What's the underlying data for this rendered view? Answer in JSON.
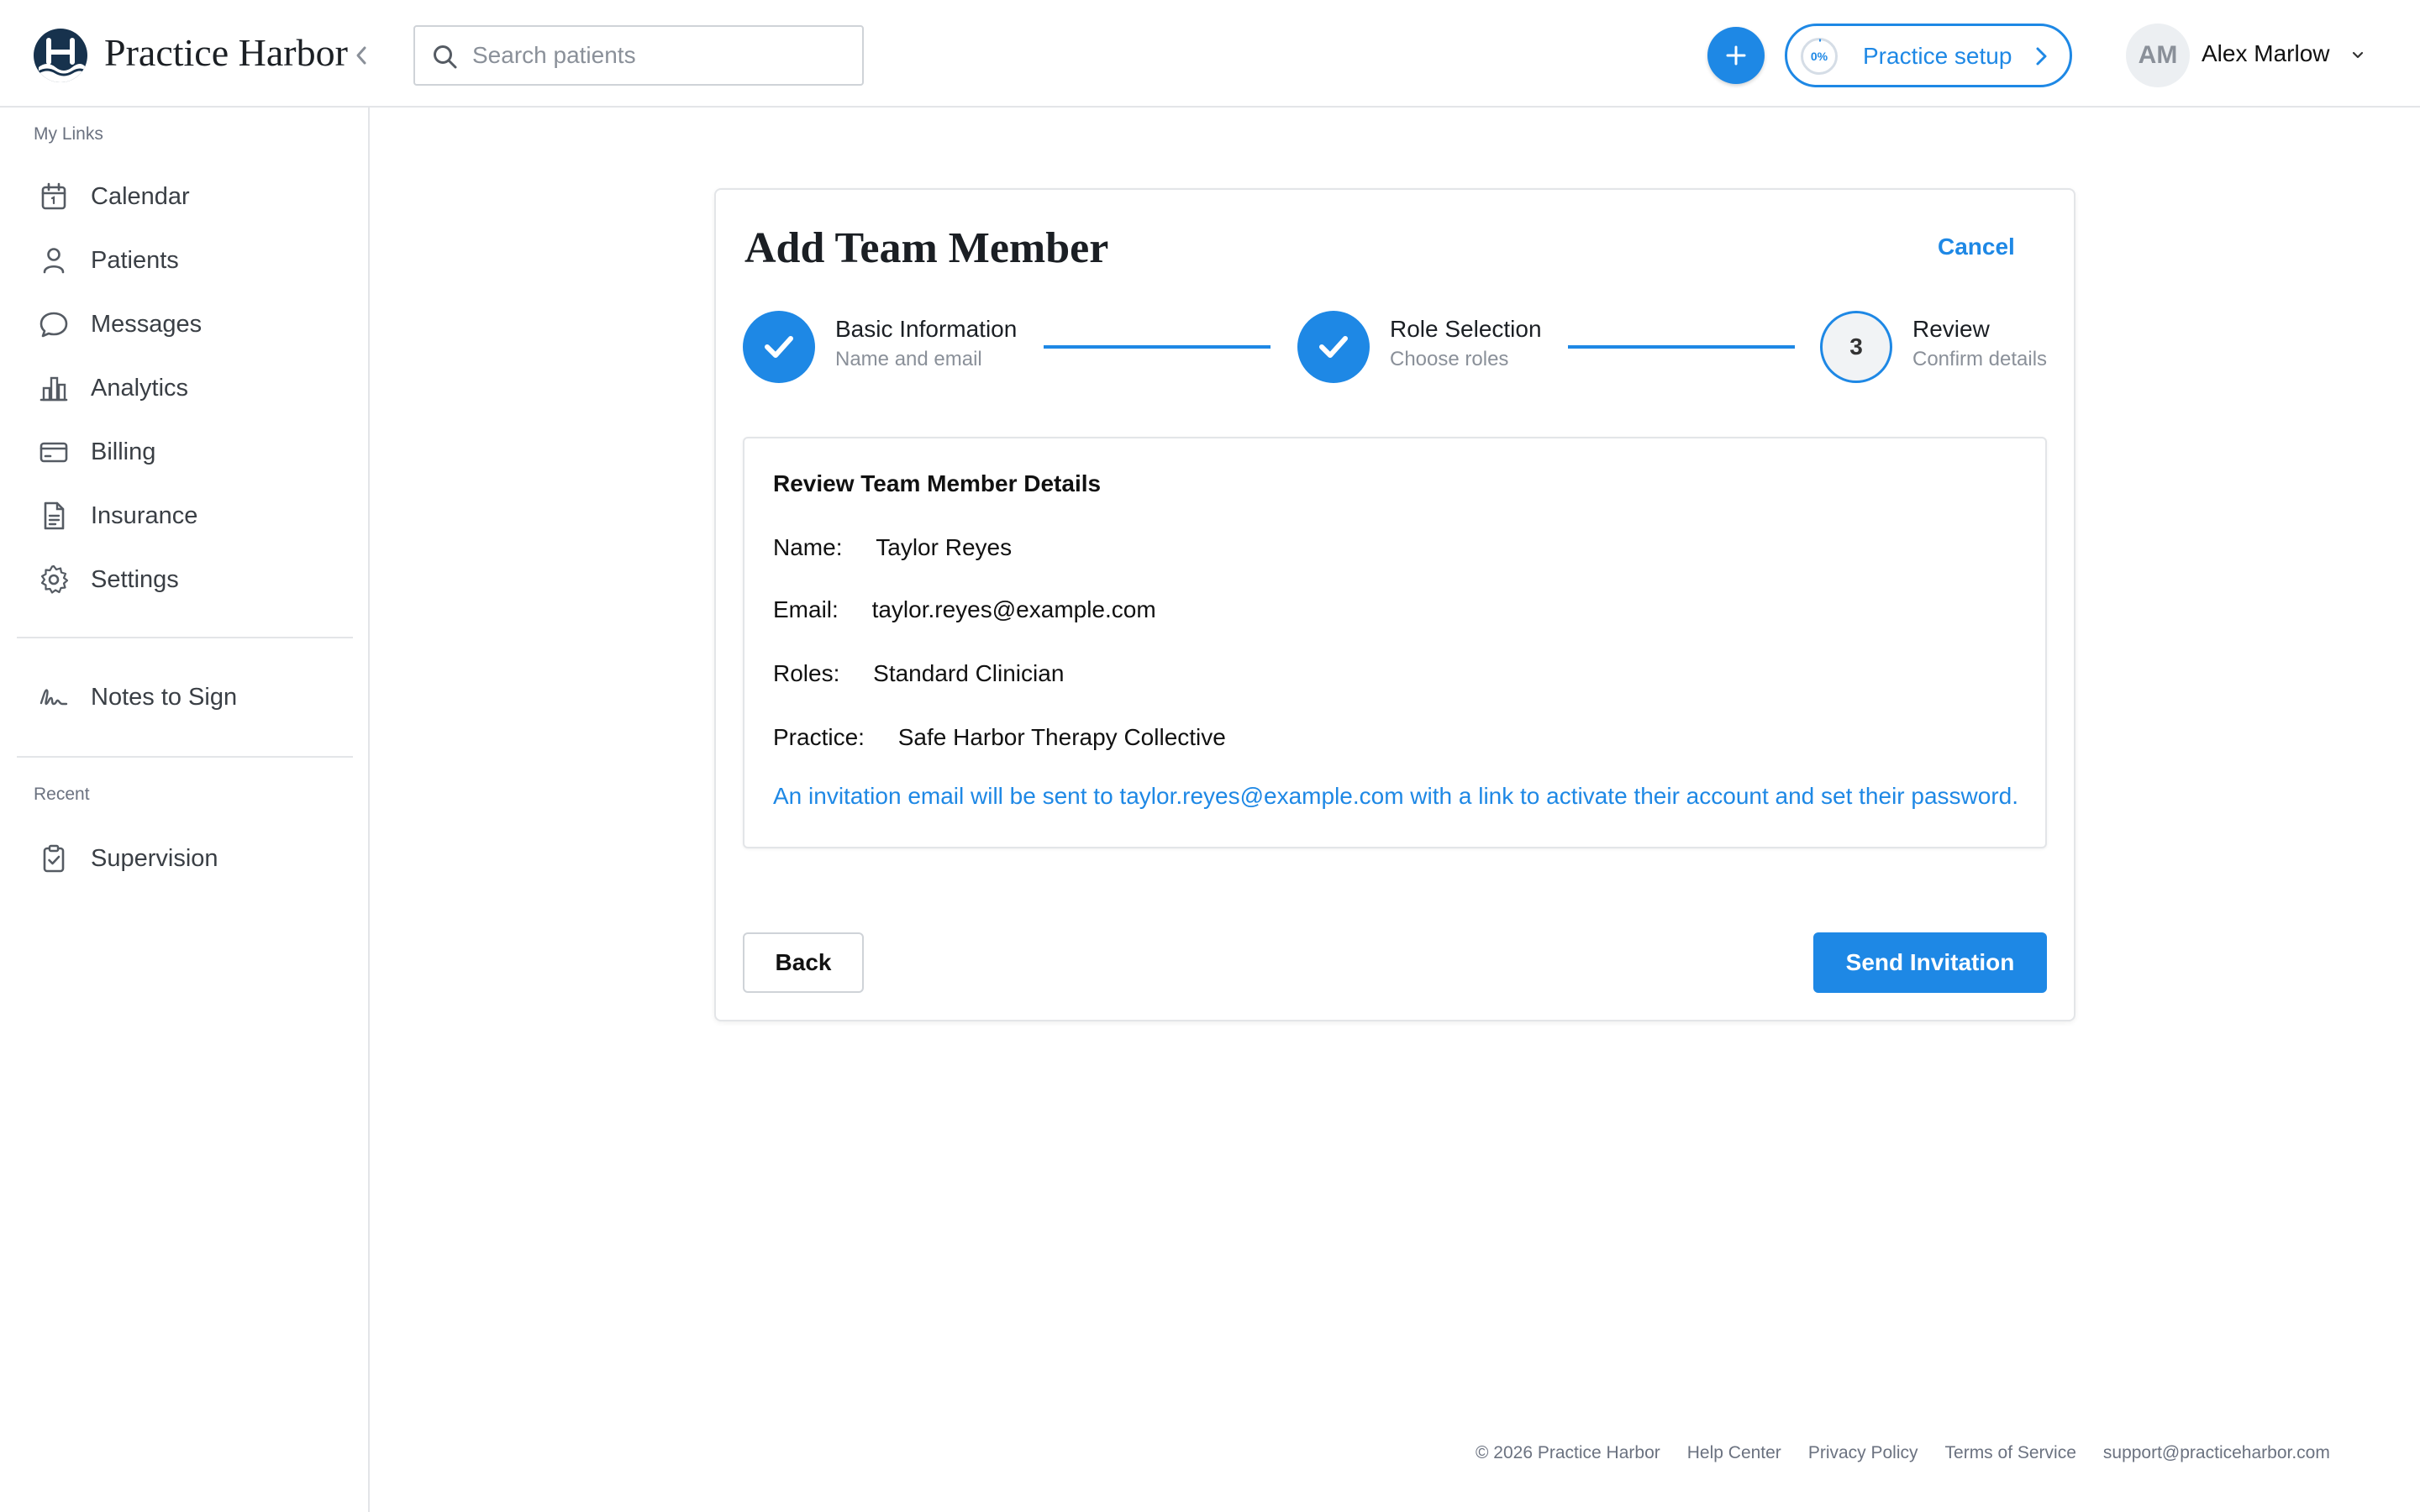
{
  "brand": {
    "name": "Practice Harbor"
  },
  "search": {
    "placeholder": "Search patients"
  },
  "header": {
    "setup_progress": "0%",
    "setup_label": "Practice setup",
    "avatar_initials": "AM",
    "user_name": "Alex Marlow",
    "accent_color": "#1e88e5"
  },
  "sidebar": {
    "my_links_label": "My Links",
    "items": [
      {
        "label": "Calendar",
        "icon": "calendar-icon"
      },
      {
        "label": "Patients",
        "icon": "user-icon"
      },
      {
        "label": "Messages",
        "icon": "message-icon"
      },
      {
        "label": "Analytics",
        "icon": "bar-chart-icon"
      },
      {
        "label": "Billing",
        "icon": "credit-card-icon"
      },
      {
        "label": "Insurance",
        "icon": "document-icon"
      },
      {
        "label": "Settings",
        "icon": "gear-icon"
      }
    ],
    "notes_to_sign": {
      "label": "Notes to Sign",
      "icon": "signature-icon"
    },
    "recent_label": "Recent",
    "recent_items": [
      {
        "label": "Supervision",
        "icon": "clipboard-check-icon"
      }
    ]
  },
  "modal": {
    "title": "Add Team Member",
    "cancel_label": "Cancel",
    "steps": [
      {
        "title": "Basic Information",
        "subtitle": "Name and email",
        "status": "complete"
      },
      {
        "title": "Role Selection",
        "subtitle": "Choose roles",
        "status": "complete"
      },
      {
        "number": "3",
        "title": "Review",
        "subtitle": "Confirm details",
        "status": "current"
      }
    ],
    "review": {
      "heading": "Review Team Member Details",
      "fields": [
        {
          "key": "Name:",
          "value": "Taylor Reyes"
        },
        {
          "key": "Email:",
          "value": "taylor.reyes@example.com"
        },
        {
          "key": "Roles:",
          "value": "Standard Clinician"
        },
        {
          "key": "Practice:",
          "value": "Safe Harbor Therapy Collective"
        }
      ],
      "notice": "An invitation email will be sent to taylor.reyes@example.com with a link to activate their account and set their password."
    },
    "back_label": "Back",
    "send_label": "Send Invitation"
  },
  "footer": {
    "copyright": "© 2026 Practice Harbor",
    "links": [
      "Help Center",
      "Privacy Policy",
      "Terms of Service",
      "support@practiceharbor.com"
    ]
  }
}
